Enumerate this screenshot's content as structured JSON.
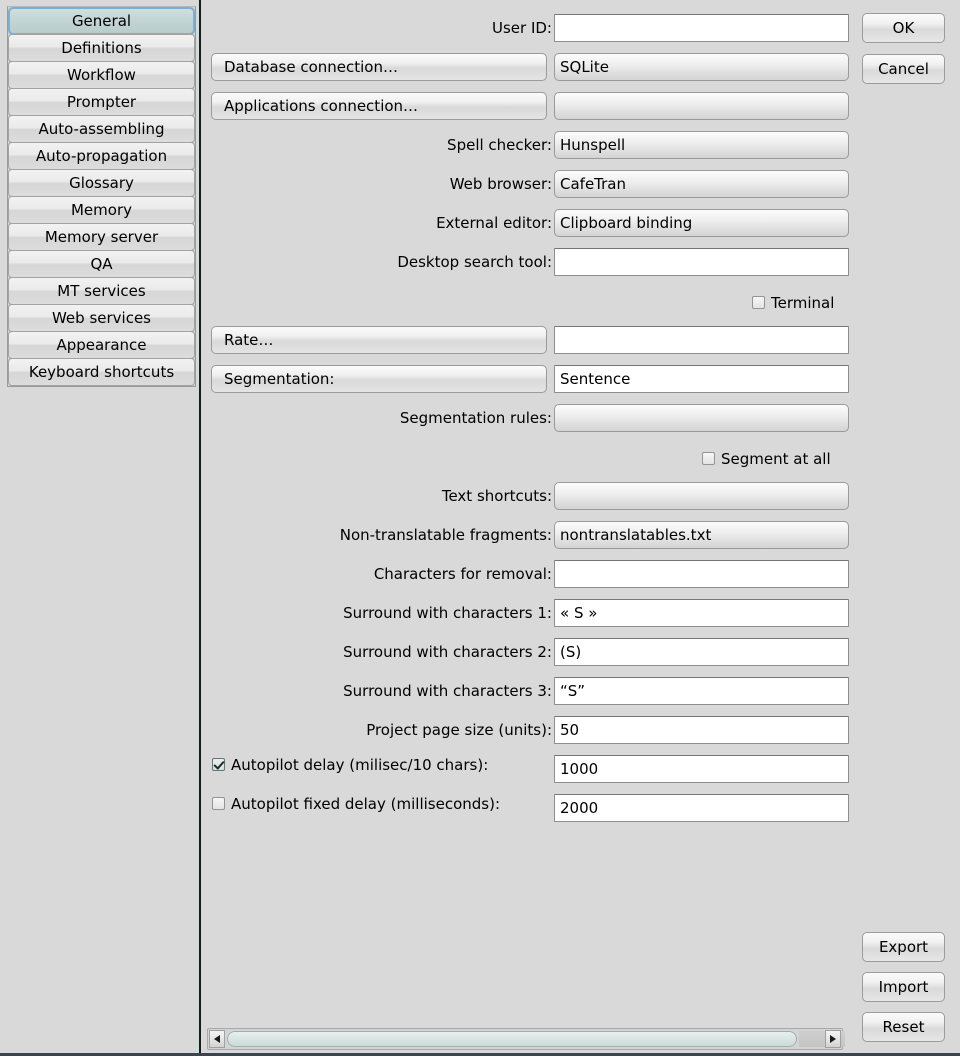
{
  "sidebar": {
    "items": [
      {
        "label": "General",
        "selected": true
      },
      {
        "label": "Definitions",
        "selected": false
      },
      {
        "label": "Workflow",
        "selected": false
      },
      {
        "label": "Prompter",
        "selected": false
      },
      {
        "label": "Auto-assembling",
        "selected": false
      },
      {
        "label": "Auto-propagation",
        "selected": false
      },
      {
        "label": "Glossary",
        "selected": false
      },
      {
        "label": "Memory",
        "selected": false
      },
      {
        "label": "Memory server",
        "selected": false
      },
      {
        "label": "QA",
        "selected": false
      },
      {
        "label": "MT services",
        "selected": false
      },
      {
        "label": "Web services",
        "selected": false
      },
      {
        "label": "Appearance",
        "selected": false
      },
      {
        "label": "Keyboard shortcuts",
        "selected": false
      }
    ]
  },
  "actions": {
    "ok": "OK",
    "cancel": "Cancel",
    "export": "Export",
    "import": "Import",
    "reset": "Reset"
  },
  "form": {
    "user_id": {
      "label": "User ID:",
      "value": ""
    },
    "database_connection": {
      "button": "Database connection…",
      "value": "SQLite"
    },
    "applications_connection": {
      "button": "Applications connection…",
      "value": ""
    },
    "spell_checker": {
      "label": "Spell checker:",
      "value": "Hunspell"
    },
    "web_browser": {
      "label": "Web browser:",
      "value": "CafeTran"
    },
    "external_editor": {
      "label": "External editor:",
      "value": "Clipboard binding"
    },
    "desktop_search_tool": {
      "label": "Desktop search tool:",
      "value": ""
    },
    "terminal": {
      "label": "Terminal",
      "checked": false
    },
    "rate": {
      "button": "Rate…",
      "value": ""
    },
    "segmentation": {
      "button": "Segmentation:",
      "value": "Sentence"
    },
    "segmentation_rules": {
      "label": "Segmentation rules:",
      "value": ""
    },
    "segment_at_all": {
      "label": "Segment at all",
      "checked": false
    },
    "text_shortcuts": {
      "label": "Text shortcuts:",
      "value": ""
    },
    "non_translatable_fragments": {
      "label": "Non-translatable fragments:",
      "value": "nontranslatables.txt"
    },
    "characters_for_removal": {
      "label": "Characters for removal:",
      "value": ""
    },
    "surround_1": {
      "label": "Surround with characters 1:",
      "value": "« S »"
    },
    "surround_2": {
      "label": "Surround with characters 2:",
      "value": "(S)"
    },
    "surround_3": {
      "label": "Surround with characters 3:",
      "value": "“S”"
    },
    "project_page_size": {
      "label": "Project page size (units):",
      "value": "50"
    },
    "autopilot_delay": {
      "label": "Autopilot delay (milisec/10 chars):",
      "value": "1000",
      "checked": true
    },
    "autopilot_fixed_delay": {
      "label": "Autopilot fixed delay (milliseconds):",
      "value": "2000",
      "checked": false
    }
  },
  "scrollbar": {
    "left_arrow": "scroll-left",
    "right_arrow": "scroll-right"
  },
  "colors": {
    "window_background": "#d9d9d9",
    "selection_border": "#7aaed4",
    "selection_fill": "#c2d4d4",
    "scrollbar_thumb": "#dae6e3",
    "field_background": "#ffffff"
  }
}
